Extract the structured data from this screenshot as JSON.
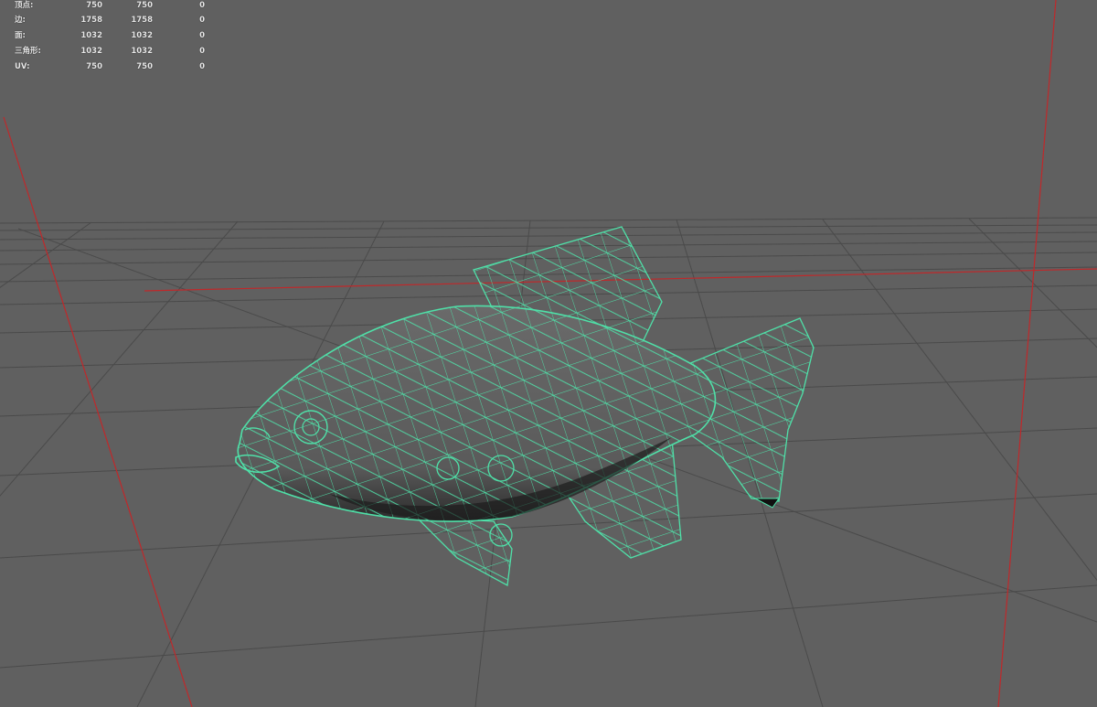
{
  "hud": {
    "rows": [
      {
        "label": "顶点:",
        "values": [
          "750",
          "750",
          "0"
        ]
      },
      {
        "label": "边:",
        "values": [
          "1758",
          "1758",
          "0"
        ]
      },
      {
        "label": "面:",
        "values": [
          "1032",
          "1032",
          "0"
        ]
      },
      {
        "label": "三角形:",
        "values": [
          "1032",
          "1032",
          "0"
        ]
      },
      {
        "label": "UV:",
        "values": [
          "750",
          "750",
          "0"
        ]
      }
    ]
  },
  "viewport": {
    "background_color": "#606060",
    "grid_color": "#4a4a4a",
    "axis_color": "#c0282a",
    "wireframe_color": "#4fe0a8",
    "model": "fish-wireframe"
  }
}
